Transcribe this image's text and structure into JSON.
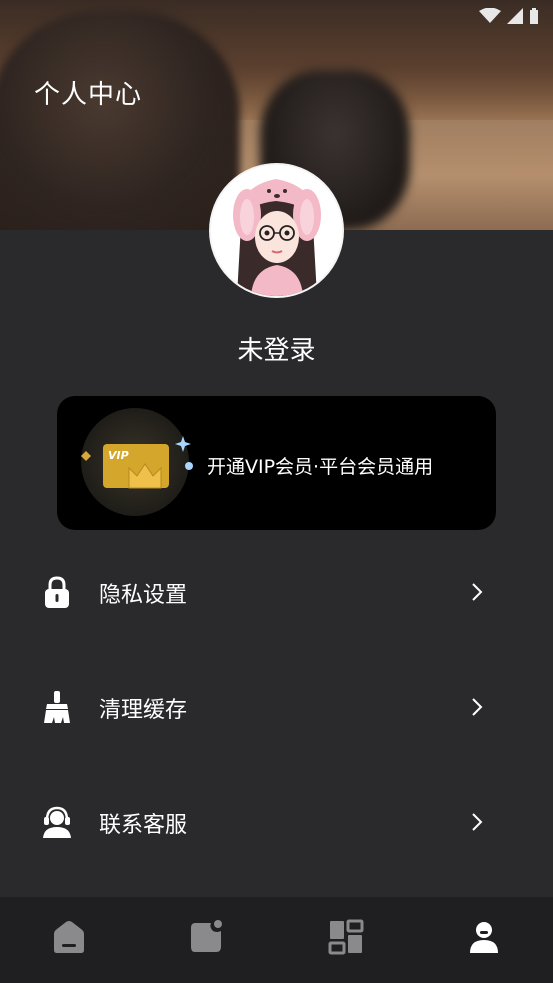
{
  "header": {
    "title": "个人中心"
  },
  "profile": {
    "username": "未登录"
  },
  "vip": {
    "label": "开通VIP会员·平台会员通用",
    "badge_text": "VIP"
  },
  "menu": [
    {
      "label": "隐私设置",
      "icon": "lock-icon"
    },
    {
      "label": "清理缓存",
      "icon": "broom-icon"
    },
    {
      "label": "联系客服",
      "icon": "headset-icon"
    }
  ],
  "tabbar": [
    "home-icon",
    "notes-icon",
    "apps-icon",
    "profile-icon"
  ],
  "colors": {
    "background": "#2a2a2c",
    "card": "#000000",
    "tabbar": "#1f1f21",
    "inactive_tab": "#8a8a8c",
    "active_tab": "#ffffff"
  }
}
